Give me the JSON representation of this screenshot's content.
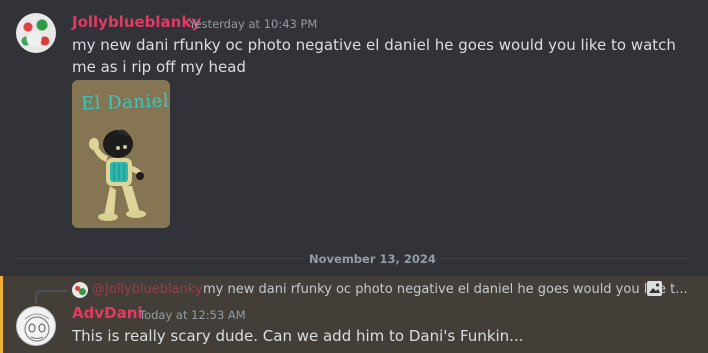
{
  "message1": {
    "username": "Jollyblueblanky",
    "timestamp": "Yesterday at 10:43 PM",
    "text": "my new dani rfunky oc photo negative el daniel he goes would you like to watch me as i rip off my head",
    "attachment_title": "El Daniel"
  },
  "divider": {
    "date": "November 13, 2024"
  },
  "message2": {
    "reply": {
      "mention": "@Jollyblueblanky",
      "preview": "my new dani rfunky oc photo negative el daniel he goes would you like t..."
    },
    "username": "AdvDani",
    "timestamp": "Today at 12:53 AM",
    "text": "This is really scary dude. Can we add him to Dani's Funkin..."
  },
  "colors": {
    "background": "#313338",
    "username": "#e23a63",
    "highlight_bg": "#433f38",
    "highlight_bar": "#f0b232"
  },
  "icons": [
    "image-icon"
  ]
}
